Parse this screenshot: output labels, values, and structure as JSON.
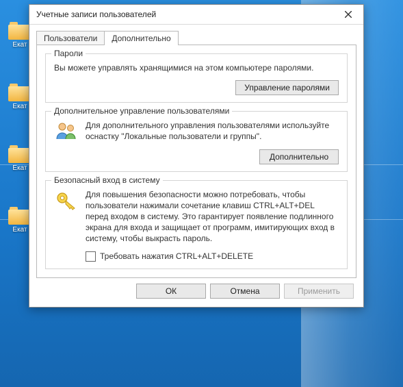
{
  "desktop": {
    "icons": [
      "Екат",
      "Екат",
      "Екат",
      "Екат"
    ]
  },
  "window": {
    "title": "Учетные записи пользователей",
    "tabs": {
      "users": "Пользователи",
      "advanced": "Дополнительно"
    },
    "groups": {
      "passwords": {
        "legend": "Пароли",
        "text": "Вы можете управлять хранящимися на этом компьютере паролями.",
        "button": "Управление паролями"
      },
      "advusers": {
        "legend": "Дополнительное управление пользователями",
        "text": "Для дополнительного управления пользователями используйте оснастку \"Локальные пользователи и группы\".",
        "button": "Дополнительно"
      },
      "securelogon": {
        "legend": "Безопасный вход в систему",
        "text": "Для повышения безопасности можно потребовать, чтобы пользователи нажимали сочетание клавиш CTRL+ALT+DEL перед входом в систему. Это гарантирует появление подлинного экрана для входа и защищает от программ, имитирующих вход в систему, чтобы выкрасть пароль.",
        "checkbox": "Требовать нажатия CTRL+ALT+DELETE"
      }
    },
    "footer": {
      "ok": "ОК",
      "cancel": "Отмена",
      "apply": "Применить"
    }
  }
}
